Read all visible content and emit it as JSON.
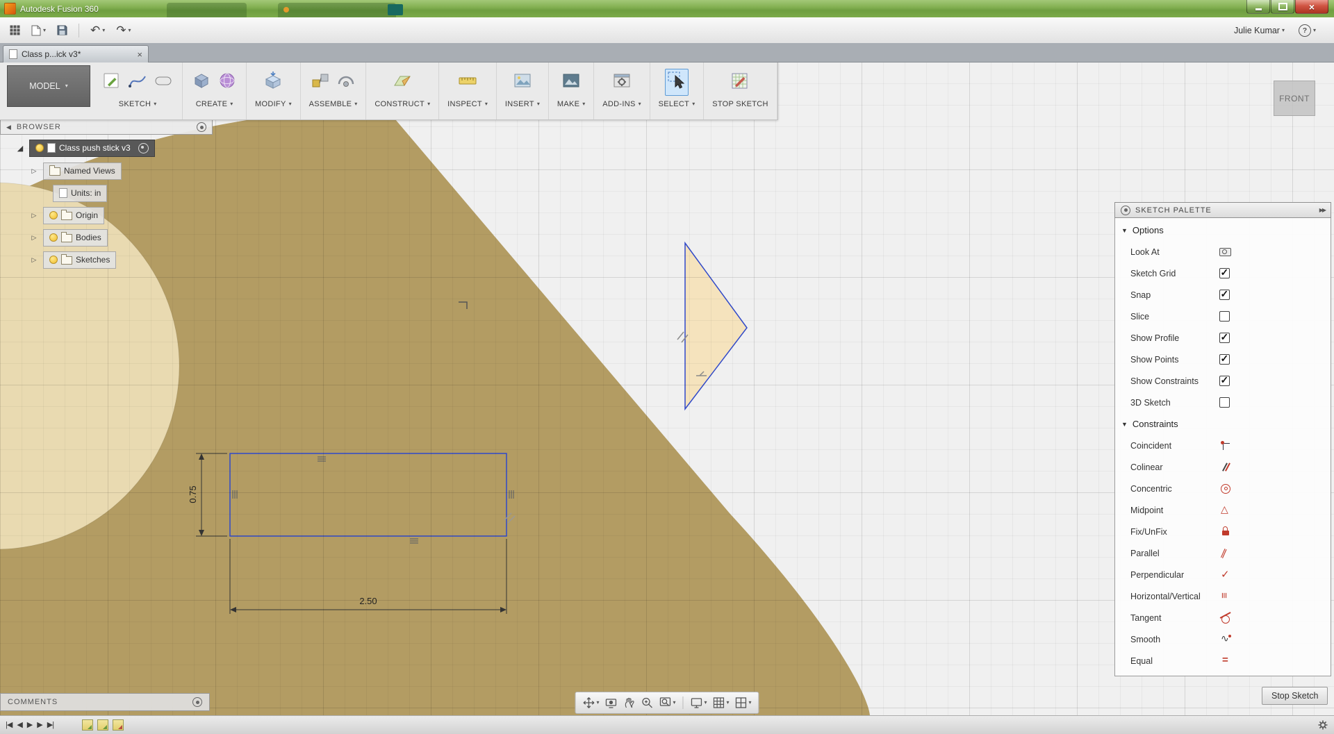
{
  "window": {
    "title": "Autodesk Fusion 360"
  },
  "qat": {
    "user_menu": "Julie Kumar",
    "help": "?"
  },
  "doc_tab": {
    "label": "Class p...ick v3*"
  },
  "ribbon": {
    "workspace": "MODEL",
    "groups": [
      {
        "label": "SKETCH"
      },
      {
        "label": "CREATE"
      },
      {
        "label": "MODIFY"
      },
      {
        "label": "ASSEMBLE"
      },
      {
        "label": "CONSTRUCT"
      },
      {
        "label": "INSPECT"
      },
      {
        "label": "INSERT"
      },
      {
        "label": "MAKE"
      },
      {
        "label": "ADD-INS"
      },
      {
        "label": "SELECT"
      },
      {
        "label": "STOP SKETCH"
      }
    ]
  },
  "viewcube": {
    "front_face": "FRONT"
  },
  "browser": {
    "header": "BROWSER",
    "root": {
      "label": "Class push stick v3"
    },
    "items": [
      {
        "label": "Named Views",
        "arrow": true,
        "icon": "folder",
        "bulb": false,
        "indent": false
      },
      {
        "label": "Units: in",
        "arrow": false,
        "icon": "doc",
        "bulb": false,
        "indent": true
      },
      {
        "label": "Origin",
        "arrow": true,
        "icon": "folder",
        "bulb": true,
        "indent": false
      },
      {
        "label": "Bodies",
        "arrow": true,
        "icon": "folder",
        "bulb": true,
        "indent": false
      },
      {
        "label": "Sketches",
        "arrow": true,
        "icon": "folder",
        "bulb": true,
        "indent": false
      }
    ]
  },
  "sketch": {
    "width_dim": "2.50",
    "height_dim": "0.75"
  },
  "palette": {
    "title": "SKETCH PALETTE",
    "options_title": "Options",
    "options": [
      {
        "label": "Look At",
        "type": "icon"
      },
      {
        "label": "Sketch Grid",
        "type": "checkbox",
        "checked": true
      },
      {
        "label": "Snap",
        "type": "checkbox",
        "checked": true
      },
      {
        "label": "Slice",
        "type": "checkbox",
        "checked": false
      },
      {
        "label": "Show Profile",
        "type": "checkbox",
        "checked": true
      },
      {
        "label": "Show Points",
        "type": "checkbox",
        "checked": true
      },
      {
        "label": "Show Constraints",
        "type": "checkbox",
        "checked": true
      },
      {
        "label": "3D Sketch",
        "type": "checkbox",
        "checked": false
      }
    ],
    "constraints_title": "Constraints",
    "constraints": [
      {
        "label": "Coincident",
        "key": "coincident"
      },
      {
        "label": "Colinear",
        "key": "colinear"
      },
      {
        "label": "Concentric",
        "key": "concentric"
      },
      {
        "label": "Midpoint",
        "key": "midpoint"
      },
      {
        "label": "Fix/UnFix",
        "key": "fix"
      },
      {
        "label": "Parallel",
        "key": "parallel"
      },
      {
        "label": "Perpendicular",
        "key": "perpendicular"
      },
      {
        "label": "Horizontal/Vertical",
        "key": "horizvert"
      },
      {
        "label": "Tangent",
        "key": "tangent"
      },
      {
        "label": "Smooth",
        "key": "smooth"
      },
      {
        "label": "Equal",
        "key": "equal"
      }
    ],
    "stop_button": "Stop Sketch"
  },
  "comments": {
    "label": "COMMENTS"
  },
  "icons": {
    "caret_down": "▾",
    "section_arrow": "▼",
    "tree_expand": "▷",
    "root_expand": "◢",
    "browser_collapse": "◀",
    "palette_expand": "▶▶",
    "undo": "↶",
    "redo": "↷",
    "close": "×",
    "skip_start": "|◀",
    "step_back": "◀",
    "play": "▶",
    "step_forward": "▶",
    "skip_end": "▶|"
  },
  "colors": {
    "titlebar_green": "#7fae4e",
    "body_tan": "#b39c63",
    "body_cream": "#e9dab1",
    "sketch_blue": "#3049c9",
    "select_highlight": "#cfe6fb"
  }
}
